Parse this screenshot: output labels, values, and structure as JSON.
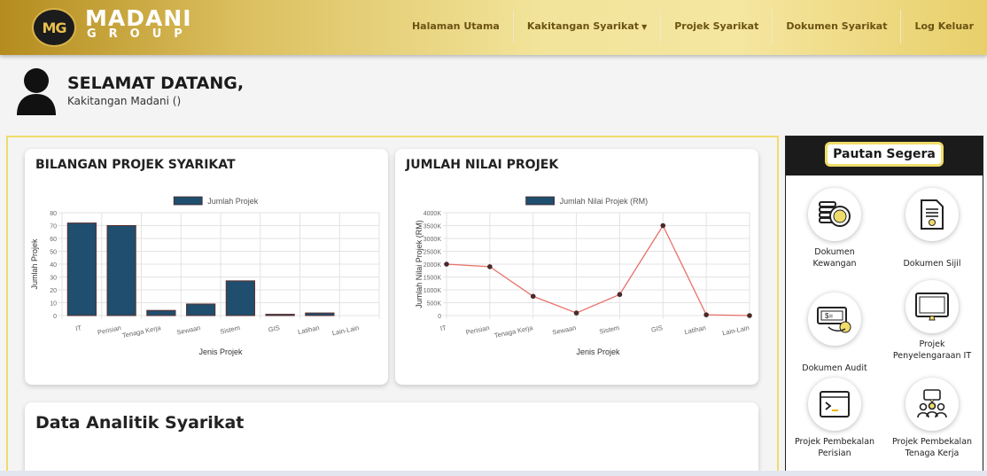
{
  "header": {
    "logo_mark": "MG",
    "logo_word": "MADANI",
    "logo_sub": "GROUP",
    "nav": [
      {
        "label": "Halaman Utama"
      },
      {
        "label": "Kakitangan Syarikat"
      },
      {
        "label": "Projek Syarikat"
      },
      {
        "label": "Dokumen Syarikat"
      },
      {
        "label": "Log Keluar"
      }
    ]
  },
  "welcome": {
    "title": "SELAMAT DATANG,",
    "subtitle": "Kakitangan Madani ()"
  },
  "cards": {
    "projects_title": "BILANGAN PROJEK SYARIKAT",
    "value_title": "JUMLAH NILAI PROJEK",
    "analytics_title": "Data Analitik Syarikat"
  },
  "sidebar": {
    "title": "Pautan Segera",
    "links": [
      {
        "label": "Dokumen Kewangan",
        "icon": "coins-icon"
      },
      {
        "label": "Dokumen Sijil",
        "icon": "certificate-icon"
      },
      {
        "label": "Dokumen Audit",
        "icon": "money-audit-icon"
      },
      {
        "label": "Projek Penyelengaraan IT",
        "icon": "monitor-icon"
      },
      {
        "label": "Projek Pembekalan Perisian",
        "icon": "terminal-icon"
      },
      {
        "label": "Projek Pembekalan Tenaga Kerja",
        "icon": "team-icon"
      }
    ]
  },
  "chart_data": [
    {
      "type": "bar",
      "legend": "Jumlah Projek",
      "categories": [
        "IT",
        "Perisian",
        "Tenaga Kerja",
        "Sewaan",
        "Sistem",
        "GIS",
        "Latihan",
        "Lain-Lain"
      ],
      "series": [
        {
          "name": "Jumlah Projek",
          "values": [
            72,
            70,
            4,
            9,
            27,
            1,
            2,
            0
          ]
        }
      ],
      "xlabel": "Jenis Projek",
      "ylabel": "Jumlah Projek",
      "ylim": [
        0,
        80
      ],
      "yticks": [
        "0",
        "10",
        "20",
        "30",
        "40",
        "50",
        "60",
        "70",
        "80"
      ],
      "color": "#1f4e6e",
      "grid": true,
      "legend_position": "top"
    },
    {
      "type": "line",
      "legend": "Jumlah Nilai Projek (RM)",
      "categories": [
        "IT",
        "Perisian",
        "Tenaga Kerja",
        "Sewaan",
        "Sistem",
        "GIS",
        "Latihan",
        "Lain-Lain"
      ],
      "series": [
        {
          "name": "Jumlah Nilai Projek (RM)",
          "values": [
            2000000,
            1900000,
            750000,
            100000,
            820000,
            3500000,
            30000,
            0
          ]
        }
      ],
      "xlabel": "Jenis Projek",
      "ylabel": "Jumlah Nilai Projek (RM)",
      "ylim": [
        0,
        4000000
      ],
      "yticks": [
        "0",
        "500K",
        "1000K",
        "1500K",
        "2000K",
        "2500K",
        "3000K",
        "3500K",
        "4000K"
      ],
      "legend_color": "#1f4e6e",
      "line_color": "#e8706a",
      "point_color": "#4a2a2a",
      "grid": true,
      "legend_position": "top"
    }
  ]
}
